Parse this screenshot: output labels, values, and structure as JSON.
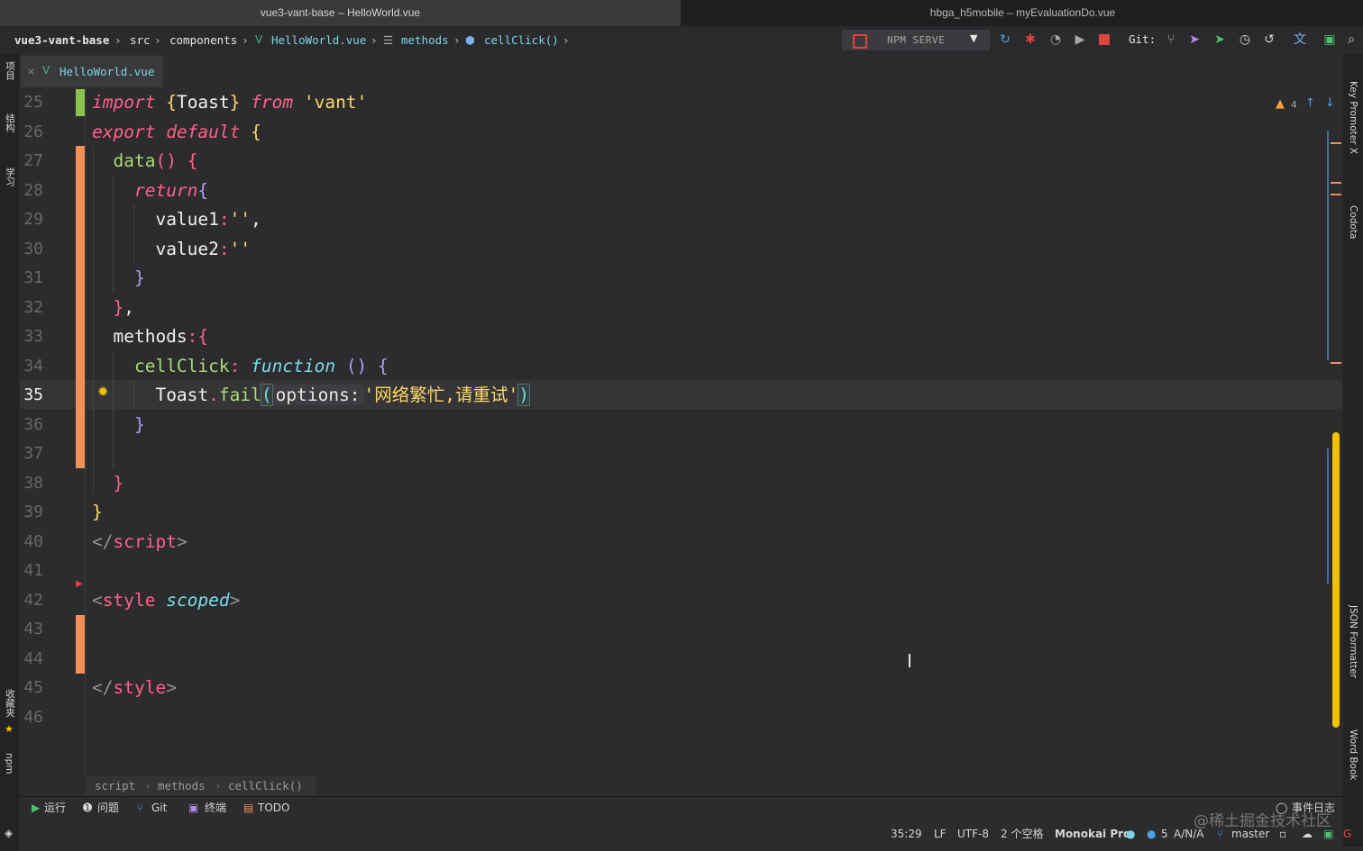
{
  "window_tabs": [
    "vue3-vant-base – HelloWorld.vue",
    "hbga_h5mobile – myEvaluationDo.vue"
  ],
  "nav": {
    "project": "vue3-vant-base",
    "crumbs": [
      "src",
      "components",
      "HelloWorld.vue",
      "methods",
      "cellClick()"
    ]
  },
  "toolbar": {
    "run_config": "NPM SERVE",
    "git_label": "Git:"
  },
  "editor": {
    "tab_label": "HelloWorld.vue",
    "warnings": "4",
    "line_numbers": [
      "25",
      "26",
      "27",
      "28",
      "29",
      "30",
      "31",
      "32",
      "33",
      "34",
      "35",
      "36",
      "37",
      "38",
      "39",
      "40",
      "41",
      "42",
      "43",
      "44",
      "45",
      "46"
    ],
    "current_line": "35"
  },
  "code": {
    "l25": {
      "kw1": "import",
      "b1": "{",
      "id": "Toast",
      "b2": "}",
      "kw2": "from",
      "str": "'vant'"
    },
    "l26": {
      "kw1": "export",
      "kw2": "default",
      "b": "{"
    },
    "l27": {
      "fn": "data",
      "p": "()",
      "b": "{"
    },
    "l28": {
      "kw": "return",
      "b": "{"
    },
    "l29": {
      "id": "value1",
      "c": ":",
      "str": "''",
      "comma": ","
    },
    "l30": {
      "id": "value2",
      "c": ":",
      "str": "''"
    },
    "l31": {
      "b": "}"
    },
    "l32": {
      "b": "}",
      "comma": ","
    },
    "l33": {
      "id": "methods",
      "c": ":",
      "b": "{"
    },
    "l34": {
      "fn": "cellClick",
      "c": ":",
      "kw": "function",
      "p": "()",
      "b": "{"
    },
    "l35": {
      "id": "Toast",
      "dot": ".",
      "fn": "fail",
      "p1": "(",
      "hint": "options:",
      "str": "'网络繁忙,请重试'",
      "p2": ")"
    },
    "l36": {
      "b": "}"
    },
    "l38": {
      "b": "}"
    },
    "l39": {
      "b": "}"
    },
    "l40": {
      "lt": "</",
      "tag": "script",
      "gt": ">"
    },
    "l42": {
      "lt": "<",
      "tag": "style",
      "attr": "scoped",
      "gt": ">"
    },
    "l45": {
      "lt": "</",
      "tag": "style",
      "gt": ">"
    }
  },
  "left_strip": [
    "项目",
    "结构",
    "学习",
    "收藏夹",
    "npm"
  ],
  "right_strip": [
    "Key Promoter X",
    "Codota",
    "JSON Formatter",
    "Word Book"
  ],
  "bottom_breadcrumbs": [
    "script",
    "methods",
    "cellClick()"
  ],
  "tool_windows": [
    "运行",
    "问题",
    "Git",
    "终端",
    "TODO",
    "事件日志"
  ],
  "status": {
    "position": "35:29",
    "line_sep": "LF",
    "encoding": "UTF-8",
    "indent": "2 个空格",
    "theme": "Monokai Pro",
    "count": "5",
    "na": "A/N/A",
    "branch": "master"
  },
  "watermark": "@稀土掘金技术社区"
}
